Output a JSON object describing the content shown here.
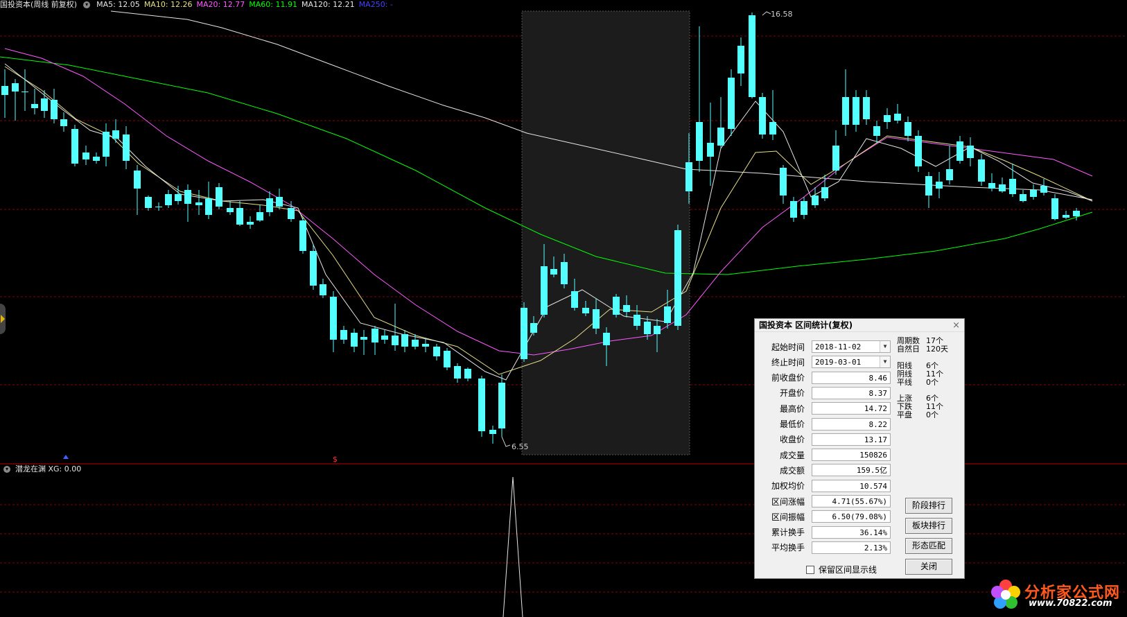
{
  "top_bar": {
    "title": "国投资本(周线 前复权)",
    "ma5": "MA5: 12.05",
    "ma10": "MA10: 12.26",
    "ma20": "MA20: 12.77",
    "ma60": "MA60: 11.91",
    "ma120": "MA120: 12.21",
    "ma250": "MA250: -"
  },
  "colors": {
    "up": "#e03030",
    "down": "#54ffff",
    "ma5": "#e6e6e6",
    "ma10": "#e6e08a",
    "ma20": "#ff5aff",
    "ma60": "#00ff00",
    "ma120": "#e6e6e6",
    "ma250": "#4040ff",
    "grid": "#8a0000"
  },
  "price_labels": {
    "high": "16.58",
    "low": "6.55"
  },
  "indicator": {
    "title": "潜龙在渊 XG: 0.00"
  },
  "chart_data": {
    "type": "candlestick",
    "period": "weekly",
    "high_marker": 16.58,
    "low_marker": 6.55,
    "selected_range": [
      "2018-11-02",
      "2019-03-01"
    ]
  },
  "dialog": {
    "title": "国投资本 区间统计(复权)",
    "close_icon": "×",
    "fields": [
      {
        "label": "起始时间",
        "value": "2018-11-02",
        "type": "date"
      },
      {
        "label": "终止时间",
        "value": "2019-03-01",
        "type": "date"
      },
      {
        "label": "前收盘价",
        "value": "8.46"
      },
      {
        "label": "开盘价",
        "value": "8.37"
      },
      {
        "label": "最高价",
        "value": "14.72"
      },
      {
        "label": "最低价",
        "value": "8.22"
      },
      {
        "label": "收盘价",
        "value": "13.17"
      },
      {
        "label": "成交量",
        "value": "150826"
      },
      {
        "label": "成交额",
        "value": "159.5亿"
      },
      {
        "label": "加权均价",
        "value": "10.574"
      },
      {
        "label": "区间涨幅",
        "value": "4.71(55.67%)"
      },
      {
        "label": "区间振幅",
        "value": "6.50(79.08%)"
      },
      {
        "label": "累计换手",
        "value": "36.14%"
      },
      {
        "label": "平均换手",
        "value": "2.13%"
      }
    ],
    "stats": {
      "period_count_label": "周期数",
      "period_count": "17个",
      "natural_days_label": "自然日",
      "natural_days": "120天",
      "yang_label": "阳线",
      "yang": "6个",
      "yin_label": "阴线",
      "yin": "11个",
      "flat_label": "平线",
      "flat": "0个",
      "rise_label": "上涨",
      "rise": "6个",
      "fall_label": "下跌",
      "fall": "11个",
      "even_label": "平盘",
      "even": "0个"
    },
    "buttons": {
      "stage_rank": "阶段排行",
      "sector_rank": "板块排行",
      "pattern_match": "形态匹配",
      "close": "关闭"
    },
    "keep_line_label": "保留区间显示线"
  },
  "watermark": {
    "brand": "分析家公式网",
    "url": "www.70822.com"
  }
}
